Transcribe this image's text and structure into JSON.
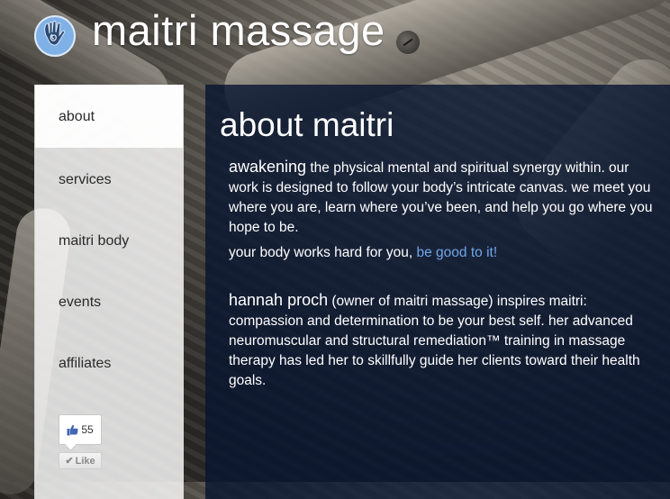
{
  "header": {
    "site_title": "maitri massage"
  },
  "sidebar": {
    "items": [
      {
        "label": "about",
        "active": true
      },
      {
        "label": "services",
        "active": false
      },
      {
        "label": "maitri body",
        "active": false
      },
      {
        "label": "events",
        "active": false
      },
      {
        "label": "affiliates",
        "active": false
      }
    ],
    "facebook": {
      "like_count": "55",
      "like_label": "Like"
    }
  },
  "main": {
    "title": "about maitri",
    "paragraphs": {
      "p1_lead": "awakening",
      "p1_text": " the physical mental and spiritual synergy within. our work is designed to follow your body’s intricate canvas. we meet you where you are, learn where you’ve been, and help you go where you hope to be.",
      "p2_text": "your body works hard for you, ",
      "p2_link": "be good to it!",
      "p3_lead": "hannah proch",
      "p3_text": " (owner of maitri massage) inspires maitri: compassion and determination to be your best self. her advanced neuromuscular and structural remediation™ training in massage therapy has led her to skillfully guide her clients toward their health goals."
    }
  },
  "colors": {
    "logo_blue": "#7fb0e6",
    "panel_navy": "#061430",
    "link_blue": "#6fa6ea"
  },
  "icons": {
    "logo": "spiral-hand-icon",
    "like": "thumbs-up-icon"
  }
}
